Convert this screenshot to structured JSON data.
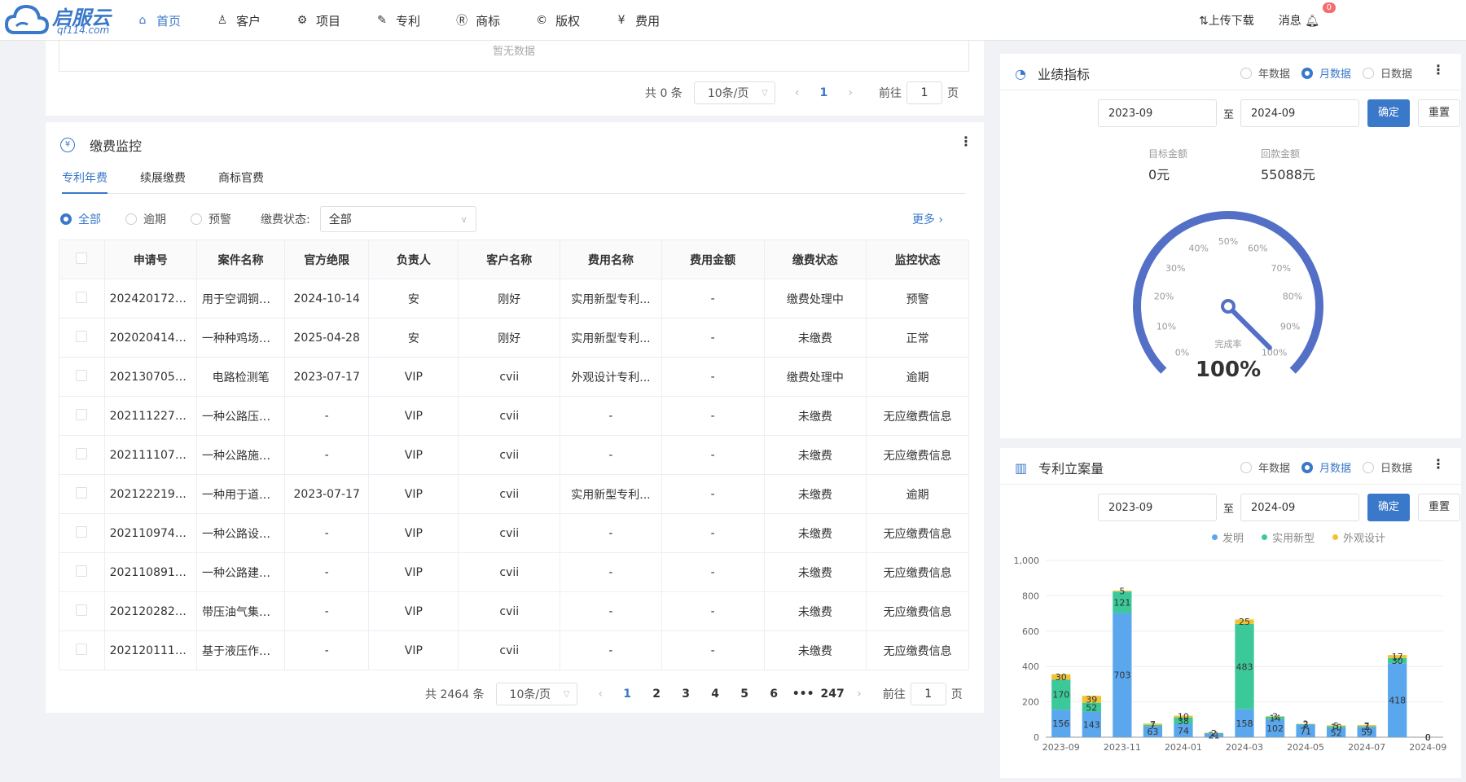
{
  "nav": {
    "brand": "启服云",
    "domain": "qf114.com",
    "items": [
      {
        "label": "首页",
        "icon": "⌂",
        "active": true
      },
      {
        "label": "客户",
        "icon": "♙",
        "active": false
      },
      {
        "label": "项目",
        "icon": "⚙",
        "active": false
      },
      {
        "label": "专利",
        "icon": "✎",
        "active": false
      },
      {
        "label": "商标",
        "icon": "Ⓡ",
        "active": false
      },
      {
        "label": "版权",
        "icon": "©",
        "active": false
      },
      {
        "label": "费用",
        "icon": "¥",
        "active": false
      }
    ],
    "upload": "⇅上传下载",
    "message": "消息",
    "message_count": "0"
  },
  "top_section": {
    "empty_text": "暂无数据",
    "total": "共 0 条",
    "page_size": "10条/页",
    "current_page": "1",
    "goto_prefix": "前往",
    "goto_value": "1",
    "goto_suffix": "页"
  },
  "fee_monitor": {
    "title": "缴费监控",
    "tabs": [
      "专利年费",
      "续展缴费",
      "商标官费"
    ],
    "filters": [
      "全部",
      "逾期",
      "预警"
    ],
    "status_label": "缴费状态:",
    "status_value": "全部",
    "more": "更多 ›",
    "columns": [
      "申请号",
      "案件名称",
      "官方绝限",
      "负责人",
      "客户名称",
      "费用名称",
      "费用金额",
      "缴费状态",
      "监控状态"
    ],
    "rows": [
      {
        "app_no": "20242017252...",
        "case": "用于空调铜管...",
        "deadline": "2024-10-14",
        "deadline_style": "orange",
        "owner": "安",
        "client": "刚好",
        "fee_name": "实用新型专利...",
        "amount": "-",
        "pay_status": "缴费处理中",
        "monitor": "预警",
        "case_link": true
      },
      {
        "app_no": "20202041496...",
        "case": "一种种鸡场人...",
        "deadline": "2025-04-28",
        "deadline_style": "muted",
        "owner": "安",
        "client": "刚好",
        "fee_name": "实用新型专利...",
        "amount": "-",
        "pay_status": "未缴费",
        "monitor": "正常",
        "case_link": false
      },
      {
        "app_no": "20213070551...",
        "case": "电路检测笔",
        "deadline": "2023-07-17",
        "deadline_style": "red",
        "owner": "VIP",
        "client": "cvii",
        "fee_name": "外观设计专利...",
        "amount": "-",
        "pay_status": "缴费处理中",
        "monitor": "逾期",
        "case_link": false
      },
      {
        "app_no": "2021112271714",
        "case": "一种公路压实...",
        "deadline": "-",
        "deadline_style": "muted",
        "owner": "VIP",
        "client": "cvii",
        "fee_name": "-",
        "amount": "-",
        "pay_status": "未缴费",
        "monitor": "无应缴费信息",
        "case_link": false
      },
      {
        "app_no": "2021111075976",
        "case": "一种公路施工...",
        "deadline": "-",
        "deadline_style": "muted",
        "owner": "VIP",
        "client": "cvii",
        "fee_name": "-",
        "amount": "-",
        "pay_status": "未缴费",
        "monitor": "无应缴费信息",
        "case_link": false
      },
      {
        "app_no": "20212221972...",
        "case": "一种用于道路...",
        "deadline": "2023-07-17",
        "deadline_style": "red",
        "owner": "VIP",
        "client": "cvii",
        "fee_name": "实用新型专利...",
        "amount": "-",
        "pay_status": "未缴费",
        "monitor": "逾期",
        "case_link": false
      },
      {
        "app_no": "20211097432...",
        "case": "一种公路设备...",
        "deadline": "-",
        "deadline_style": "muted",
        "owner": "VIP",
        "client": "cvii",
        "fee_name": "-",
        "amount": "-",
        "pay_status": "未缴费",
        "monitor": "无应缴费信息",
        "case_link": false
      },
      {
        "app_no": "20211089155...",
        "case": "一种公路建设...",
        "deadline": "-",
        "deadline_style": "muted",
        "owner": "VIP",
        "client": "cvii",
        "fee_name": "-",
        "amount": "-",
        "pay_status": "未缴费",
        "monitor": "无应缴费信息",
        "case_link": false
      },
      {
        "app_no": "20212028218...",
        "case": "带压油气集输...",
        "deadline": "-",
        "deadline_style": "muted",
        "owner": "VIP",
        "client": "cvii",
        "fee_name": "-",
        "amount": "-",
        "pay_status": "未缴费",
        "monitor": "无应缴费信息",
        "case_link": false
      },
      {
        "app_no": "2021201115065",
        "case": "基于液压作用...",
        "deadline": "-",
        "deadline_style": "muted",
        "owner": "VIP",
        "client": "cvii",
        "fee_name": "-",
        "amount": "-",
        "pay_status": "未缴费",
        "monitor": "无应缴费信息",
        "case_link": false
      }
    ],
    "pager": {
      "total": "共 2464 条",
      "page_size": "10条/页",
      "pages": [
        "1",
        "2",
        "3",
        "4",
        "5",
        "6",
        "•••",
        "247"
      ],
      "goto_prefix": "前往",
      "goto_value": "1",
      "goto_suffix": "页"
    }
  },
  "performance": {
    "title": "业绩指标",
    "modes": [
      "年数据",
      "月数据",
      "日数据"
    ],
    "active_mode": 1,
    "date_from": "2023-09",
    "to": "至",
    "date_to": "2024-09",
    "confirm": "确定",
    "reset": "重置",
    "target_label": "目标金额",
    "target_value": "0元",
    "received_label": "回款金额",
    "received_value": "55088元",
    "gauge_label": "完成率",
    "gauge_value": "100%",
    "gauge_fraction": 1.0,
    "gauge_ticks": [
      "0%",
      "10%",
      "20%",
      "30%",
      "40%",
      "50%",
      "60%",
      "70%",
      "80%",
      "90%",
      "100%"
    ],
    "accent": "#5470c6"
  },
  "patent_filing": {
    "title": "专利立案量",
    "modes": [
      "年数据",
      "月数据",
      "日数据"
    ],
    "active_mode": 1,
    "date_from": "2023-09",
    "to": "至",
    "date_to": "2024-09",
    "confirm": "确定",
    "reset": "重置"
  },
  "chart_data": {
    "type": "bar",
    "stacked": true,
    "categories": [
      "2023-09",
      "2023-10",
      "2023-11",
      "2023-12",
      "2024-01",
      "2024-02",
      "2024-03",
      "2024-04",
      "2024-05",
      "2024-06",
      "2024-07",
      "2024-08",
      "2024-09"
    ],
    "x_tick_labels": [
      "2023-09",
      "2023-11",
      "2024-01",
      "2024-03",
      "2024-05",
      "2024-07",
      "2024-09"
    ],
    "series": [
      {
        "name": "发明",
        "color": "#5aa7ee",
        "values": [
          156,
          143,
          703,
          63,
          74,
          21,
          158,
          102,
          71,
          52,
          59,
          418,
          0
        ]
      },
      {
        "name": "实用新型",
        "color": "#3cc99a",
        "values": [
          170,
          52,
          121,
          7,
          38,
          2,
          483,
          14,
          3,
          10,
          3,
          30,
          0
        ]
      },
      {
        "name": "外观设计",
        "color": "#f2c330",
        "values": [
          30,
          39,
          5,
          7,
          10,
          2,
          25,
          3,
          2,
          5,
          7,
          17,
          0
        ]
      }
    ],
    "ylim": [
      0,
      1000
    ],
    "yticks": [
      "0",
      "200",
      "400",
      "600",
      "800",
      "1,000"
    ],
    "legend_position": "top",
    "grid": true
  }
}
